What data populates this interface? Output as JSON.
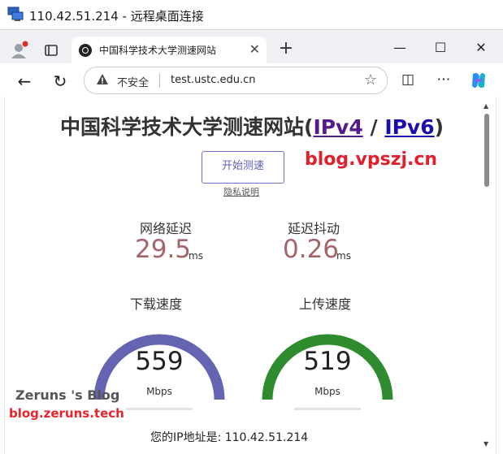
{
  "remote_window": {
    "title": "110.42.51.214 - 远程桌面连接"
  },
  "browser": {
    "tab_title": "中国科学技术大学测速网站",
    "new_tab_symbol": "+",
    "security_label": "不安全",
    "url": "test.ustc.edu.cn"
  },
  "page": {
    "title_main": "中国科学技术大学测速网站(",
    "title_ipv4": "IPv4",
    "title_slash": " / ",
    "title_ipv6": "IPv6",
    "title_close": ")",
    "start_button": "开始测速",
    "privacy_link": "隐私说明",
    "latency_label": "网络延迟",
    "latency_value": "29.5",
    "latency_unit": "ms",
    "jitter_label": "延迟抖动",
    "jitter_value": "0.26",
    "jitter_unit": "ms",
    "download_label": "下载速度",
    "download_value": "559",
    "download_unit": "Mbps",
    "upload_label": "上传速度",
    "upload_value": "519",
    "upload_unit": "Mbps",
    "ip_text": "您的IP地址是: 110.42.51.214"
  },
  "watermarks": {
    "top_right": "blog.vpszj.cn",
    "bottom_left_1": "Zeruns 's Blog",
    "bottom_left_2": "blog.zeruns.tech"
  },
  "colors": {
    "download_gauge": "#6564b0",
    "upload_gauge": "#2f8c2e",
    "metric_value": "#a3646a",
    "watermark_red": "#e0202c"
  }
}
